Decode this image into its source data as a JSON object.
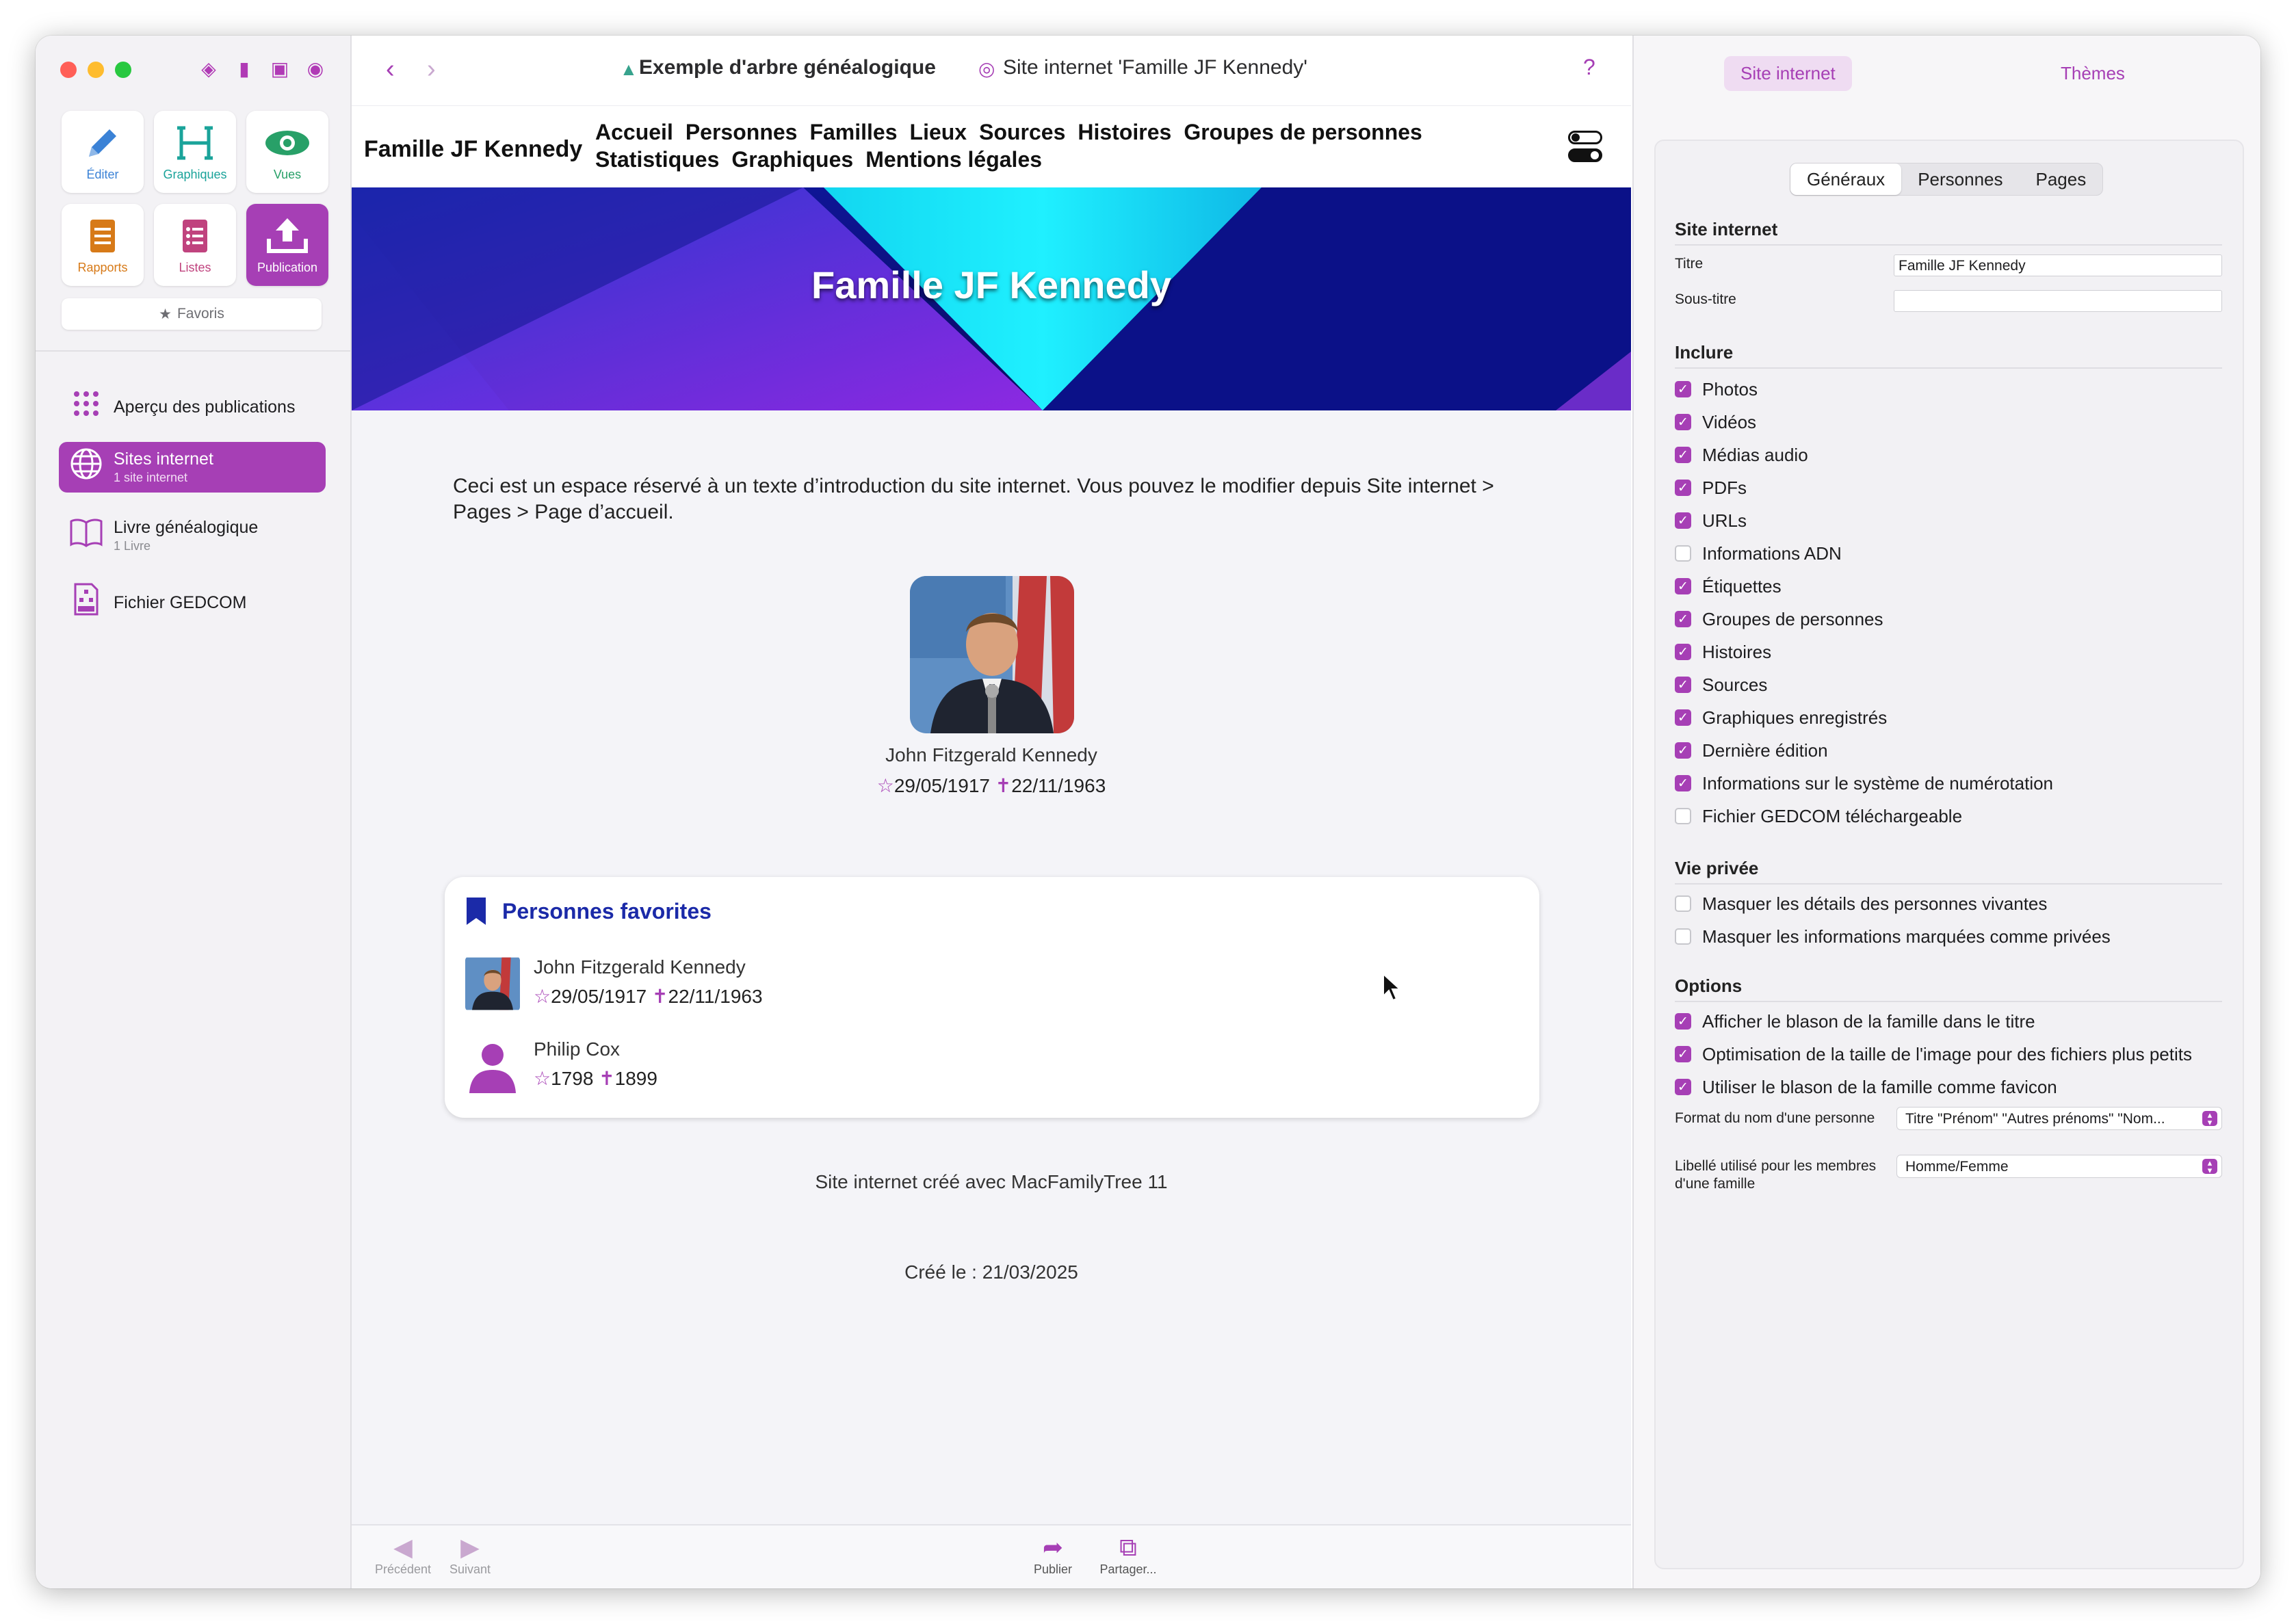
{
  "colors": {
    "accent": "#a63fb5",
    "nav_blue": "#1b2aa8",
    "close": "#ff5f57",
    "minimize": "#febc2e",
    "zoom": "#28c840"
  },
  "sidebar": {
    "modes": [
      {
        "label": "Éditer",
        "icon": "pencil-icon",
        "color": "#3b82d6"
      },
      {
        "label": "Graphiques",
        "icon": "chart-tree-icon",
        "color": "#1aa39a"
      },
      {
        "label": "Vues",
        "icon": "eye-icon",
        "color": "#28a068"
      },
      {
        "label": "Rapports",
        "icon": "report-icon",
        "color": "#d77a18"
      },
      {
        "label": "Listes",
        "icon": "list-icon",
        "color": "#c0437e"
      },
      {
        "label": "Publication",
        "icon": "upload-icon",
        "color": "#a63fb5"
      }
    ],
    "favorites": "Favoris",
    "items": [
      {
        "label": "Aperçu des publications",
        "sub": ""
      },
      {
        "label": "Sites internet",
        "sub": "1 site internet"
      },
      {
        "label": "Livre généalogique",
        "sub": "1 Livre"
      },
      {
        "label": "Fichier GEDCOM",
        "sub": ""
      }
    ]
  },
  "topbar": {
    "tab1": "Exemple d'arbre généalogique",
    "tab2": "Site internet 'Famille JF Kennedy'",
    "help": "?"
  },
  "site": {
    "brand": "Famille JF Kennedy",
    "links": [
      "Accueil",
      "Personnes",
      "Familles",
      "Lieux",
      "Sources",
      "Histoires",
      "Groupes de personnes",
      "Statistiques",
      "Graphiques",
      "Mentions légales"
    ],
    "hero_title": "Famille JF Kennedy",
    "intro": "Ceci est un espace réservé à un texte d’introduction du site internet. Vous pouvez le modifier depuis Site internet > Pages > Page d’accueil.",
    "main_person": {
      "name": "John Fitzgerald Kennedy",
      "birth": "29/05/1917",
      "death": "22/11/1963"
    },
    "favorites_title": "Personnes favorites",
    "favorites": [
      {
        "name": "John Fitzgerald Kennedy",
        "birth": "29/05/1917",
        "death": "22/11/1963"
      },
      {
        "name": "Philip Cox",
        "birth": "1798",
        "death": "1899"
      }
    ],
    "footer_created_with": "Site internet créé avec MacFamilyTree 11",
    "footer_created_on": "Créé le : 21/03/2025"
  },
  "bottombar": {
    "prev": "Précédent",
    "next": "Suivant",
    "publish": "Publier",
    "share": "Partager..."
  },
  "right": {
    "top_tabs": [
      "Site internet",
      "Thèmes"
    ],
    "seg": [
      "Généraux",
      "Personnes",
      "Pages"
    ],
    "site_section": "Site internet",
    "title_label": "Titre",
    "title_value": "Famille JF Kennedy",
    "subtitle_label": "Sous-titre",
    "subtitle_value": "",
    "include_section": "Inclure",
    "include": [
      {
        "label": "Photos",
        "checked": true
      },
      {
        "label": "Vidéos",
        "checked": true
      },
      {
        "label": "Médias audio",
        "checked": true
      },
      {
        "label": "PDFs",
        "checked": true
      },
      {
        "label": "URLs",
        "checked": true
      },
      {
        "label": "Informations ADN",
        "checked": false
      },
      {
        "label": "Étiquettes",
        "checked": true
      },
      {
        "label": "Groupes de personnes",
        "checked": true
      },
      {
        "label": "Histoires",
        "checked": true
      },
      {
        "label": "Sources",
        "checked": true
      },
      {
        "label": "Graphiques enregistrés",
        "checked": true
      },
      {
        "label": "Dernière édition",
        "checked": true
      },
      {
        "label": "Informations sur le système de numérotation",
        "checked": true
      },
      {
        "label": "Fichier GEDCOM téléchargeable",
        "checked": false
      }
    ],
    "privacy_section": "Vie privée",
    "privacy": [
      {
        "label": "Masquer les détails des personnes vivantes",
        "checked": false
      },
      {
        "label": "Masquer les informations marquées comme privées",
        "checked": false
      }
    ],
    "options_section": "Options",
    "options": [
      {
        "label": "Afficher le blason de la famille dans le titre",
        "checked": true
      },
      {
        "label": "Optimisation de la taille de l'image pour des fichiers plus petits",
        "checked": true
      },
      {
        "label": "Utiliser le blason de la famille comme favicon",
        "checked": true
      }
    ],
    "name_format_label": "Format du nom d'une personne",
    "name_format_value": "Titre \"Prénom\" \"Autres prénoms\" \"Nom...",
    "family_label_label": "Libellé utilisé pour les membres d'une famille",
    "family_label_value": "Homme/Femme"
  }
}
